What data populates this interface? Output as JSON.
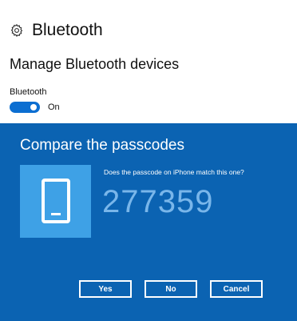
{
  "settings": {
    "header_title": "Bluetooth",
    "section_title": "Manage Bluetooth devices",
    "bluetooth_label": "Bluetooth",
    "toggle_state": "On"
  },
  "dialog": {
    "title": "Compare the passcodes",
    "question": "Does the passcode on iPhone match this one?",
    "passcode": "277359",
    "buttons": {
      "yes": "Yes",
      "no": "No",
      "cancel": "Cancel"
    }
  },
  "icons": {
    "header": "gear-icon",
    "device": "phone-icon"
  },
  "colors": {
    "dialog_background": "#0b63b2",
    "device_tile": "#3ea1e6",
    "passcode_text": "#79b6ea",
    "toggle_on": "#0b6ed1"
  }
}
